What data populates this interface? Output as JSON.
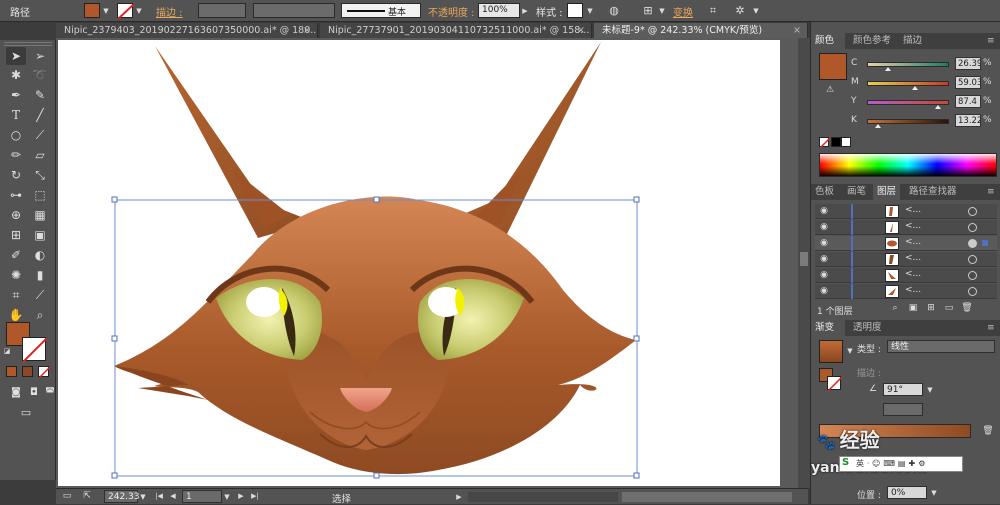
{
  "control_bar": {
    "object_type": "路径",
    "fill_color": "#b0582a",
    "stroke_label": "描边 :",
    "stroke_profile_label": "基本",
    "opacity_label": "不透明度 :",
    "opacity_value": "100%",
    "style_label": "样式 :",
    "transform_label": "变换"
  },
  "doc_tabs": [
    {
      "label": "Nipic_2379403_20190227163607350000.ai* @ 180..."
    },
    {
      "label": "Nipic_27737901_20190304110732511000.ai* @ 158..."
    },
    {
      "label": "未标题-9* @ 242.33% (CMYK/预览)"
    }
  ],
  "status_bar": {
    "zoom": "242.33",
    "artboard_number": "1",
    "tool_name": "选择"
  },
  "color_panel": {
    "tabs": [
      "颜色",
      "颜色参考",
      "描边"
    ],
    "preview_color": "#b0582a",
    "channels": [
      {
        "label": "C",
        "value": "26.39",
        "fraction": 0.26
      },
      {
        "label": "M",
        "value": "59.03",
        "fraction": 0.59
      },
      {
        "label": "Y",
        "value": "87.4",
        "fraction": 0.87
      },
      {
        "label": "K",
        "value": "13.22",
        "fraction": 0.13
      }
    ],
    "unit": "%"
  },
  "layers_panel": {
    "tabs": [
      "色板",
      "画笔",
      "图层",
      "路径查找器"
    ],
    "layer_names": [
      "<...",
      "<...",
      "<...",
      "<...",
      "<...",
      "<..."
    ],
    "footer_label": "1 个图层"
  },
  "gradient_panel": {
    "tabs": [
      "渐变",
      "透明度"
    ],
    "type_label": "类型 :",
    "type_value": "线性",
    "stroke_label": "描边 :",
    "angle_value": "91°",
    "position_label": "位置 :",
    "position_value": "0%"
  },
  "watermark": {
    "brand_text": "经验",
    "site_text": "yan.baidu.com"
  }
}
